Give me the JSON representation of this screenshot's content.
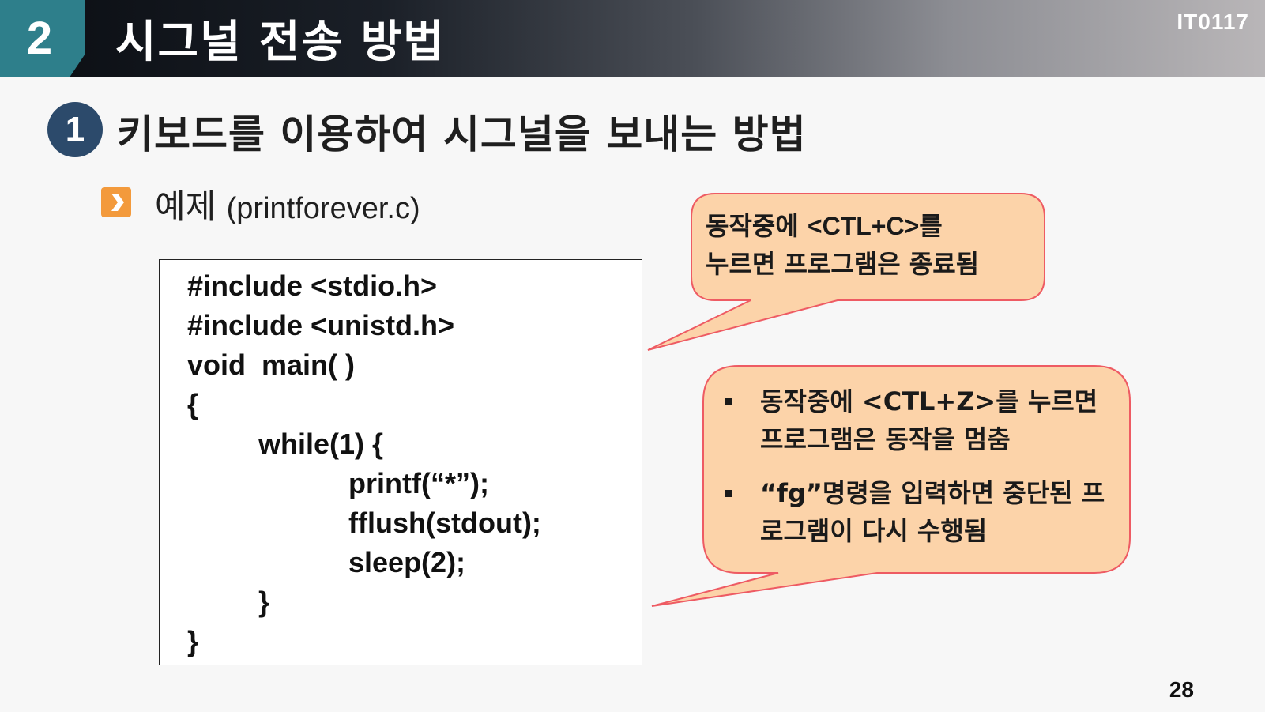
{
  "header": {
    "section_number": "2",
    "title": "시그널 전송 방법",
    "course_code": "IT0117"
  },
  "subsection": {
    "number": "1",
    "title": "키보드를 이용하여 시그널을 보내는 방법"
  },
  "example": {
    "label": "예제",
    "filename": "(printforever.c)"
  },
  "code": [
    "#include <stdio.h>",
    "#include <unistd.h>",
    "void  main( )",
    "{",
    "while(1) {",
    "printf(“*”);",
    "fflush(stdout);",
    "sleep(2);",
    "}",
    "}"
  ],
  "callout1": {
    "line1_a": "동작중에 ",
    "line1_b": "<CTL+C>",
    "line1_c": "를",
    "line2": "누르면 프로그램은 종료됨"
  },
  "callout2": {
    "items": [
      "동작중에 <CTL+Z>를 누르면 프로그램은 동작을 멈춤",
      "“fg”명령을 입력하면 중단된 프로그램이 다시 수행됨"
    ]
  },
  "page_number": "28",
  "colors": {
    "section_teal": "#2e7f8b",
    "badge_navy": "#2c4a6b",
    "bullet_orange": "#f39a3c",
    "callout_fill": "#fcd3a9",
    "callout_stroke": "#ee5b63"
  },
  "icons": {
    "bullet": "chevron-right-icon"
  }
}
